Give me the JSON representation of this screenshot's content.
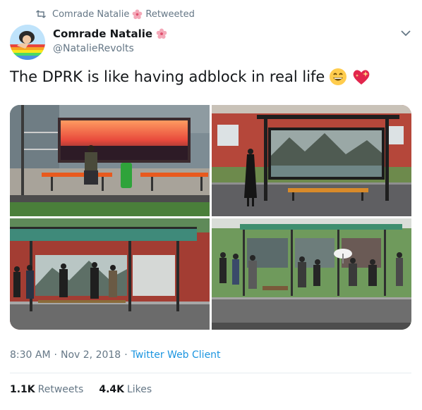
{
  "retweet_bar": {
    "retweeter": "Comrade Natalie",
    "label": "Retweeted"
  },
  "author": {
    "display_name": "Comrade Natalie",
    "handle": "@NatalieRevolts"
  },
  "tweet": {
    "text": "The DPRK is like having adblock in real life"
  },
  "meta": {
    "time": "8:30 AM",
    "date": "Nov 2, 2018",
    "separator": "·",
    "client": "Twitter Web Client"
  },
  "stats": {
    "retweets_count": "1.1K",
    "retweets_label": "Retweets",
    "likes_count": "4.4K",
    "likes_label": "Likes"
  },
  "colors": {
    "link": "#1b95e0",
    "secondary": "#657786",
    "divider": "#e6ecf0"
  },
  "icons": [
    "retweet-icon",
    "flower-emoji-icon",
    "chevron-down-icon",
    "grinning-emoji-icon",
    "sparkling-heart-emoji-icon"
  ]
}
